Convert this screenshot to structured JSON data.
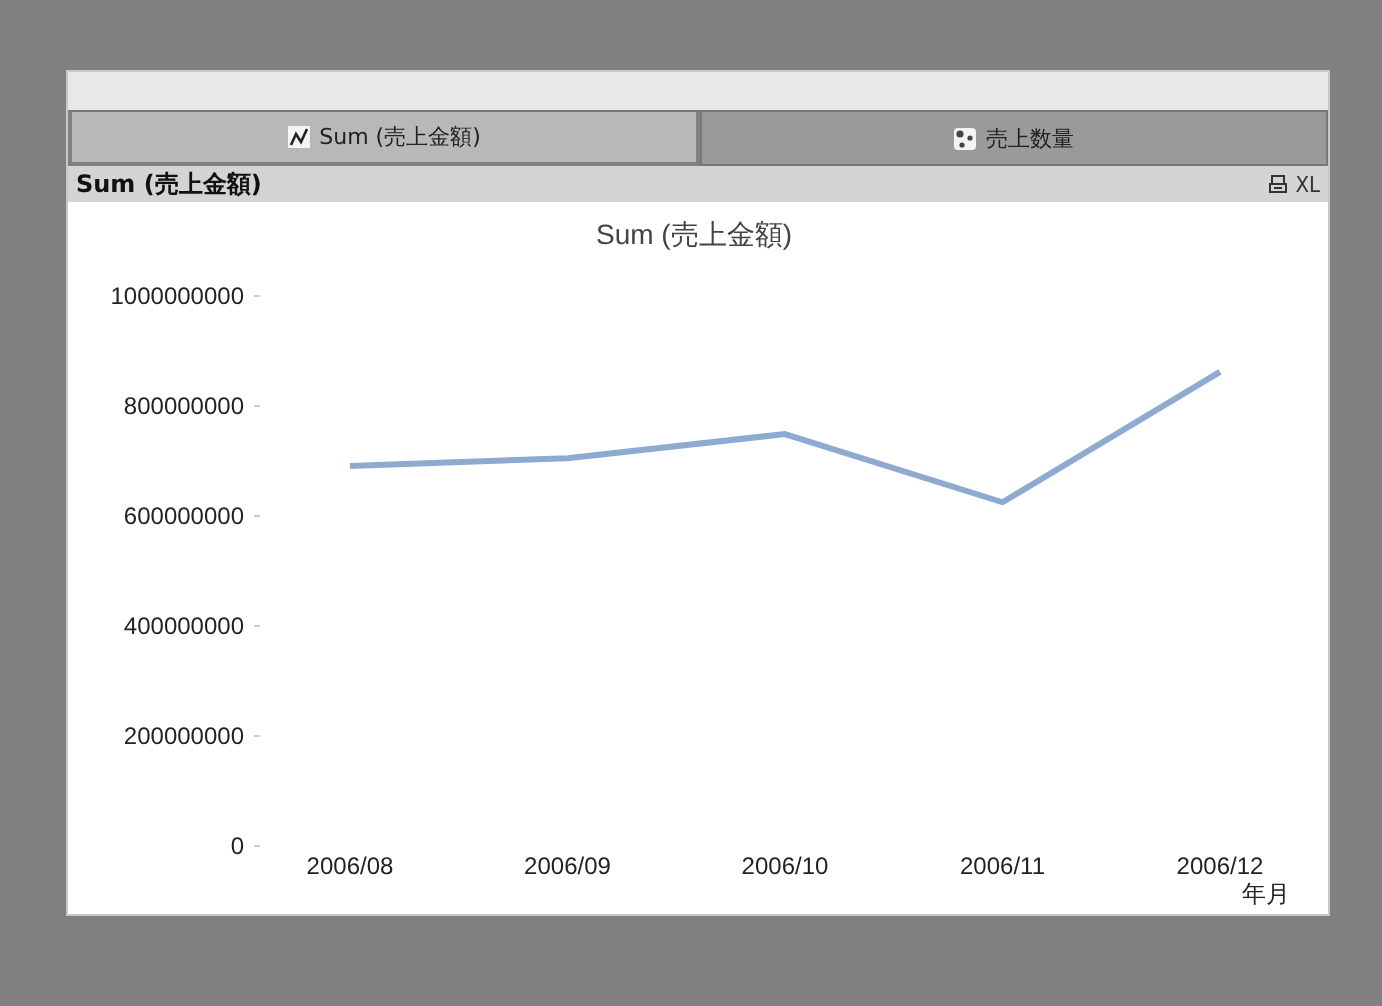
{
  "tabs": [
    {
      "label": "Sum (売上金額)",
      "selected": true,
      "kind": "line"
    },
    {
      "label": "売上数量",
      "selected": false,
      "kind": "scatter"
    }
  ],
  "caption": {
    "title": "Sum  (売上金額)",
    "export_label": "XL"
  },
  "chart": {
    "chart_data": {
      "type": "line",
      "title": "Sum (売上金額)",
      "xlabel": "年月",
      "categories": [
        "2006/08",
        "2006/09",
        "2006/10",
        "2006/11",
        "2006/12"
      ],
      "series": [
        {
          "color": "#8eaad0",
          "values": [
            691000000,
            705000000,
            749000000,
            625000000,
            862000000
          ]
        }
      ],
      "ylim": [
        0,
        1000000000
      ],
      "yticks": [
        0,
        200000000,
        400000000,
        600000000,
        800000000,
        1000000000
      ]
    }
  }
}
